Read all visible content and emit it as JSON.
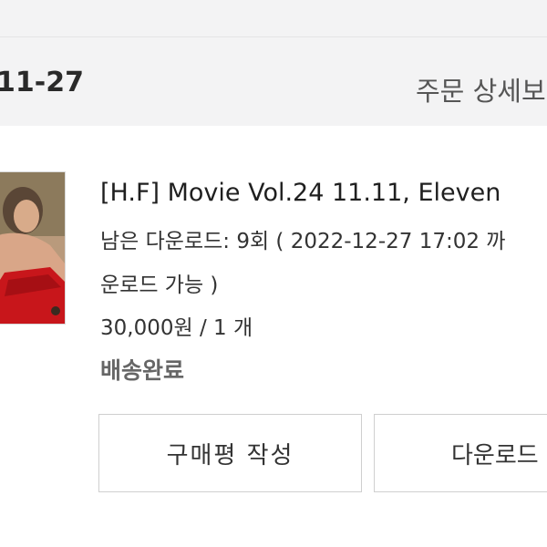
{
  "order": {
    "date": "11-27",
    "detail_link": "주문 상세보"
  },
  "product": {
    "image_alt": "product-photo",
    "title": "[H.F] Movie Vol.24 11.11, Eleven",
    "download_line_1": "남은 다운로드: 9회 ( 2022-12-27 17:02 까",
    "download_line_2": "운로드 가능 )",
    "price_qty": "30,000원 / 1 개",
    "status": "배송완료"
  },
  "actions": {
    "review_label": "구매평 작성",
    "download_label": "다운로드"
  },
  "colors": {
    "header_bg": "#f3f3f4",
    "card_bg": "#ffffff",
    "border": "#cfcfcf",
    "status_text": "#666666"
  }
}
